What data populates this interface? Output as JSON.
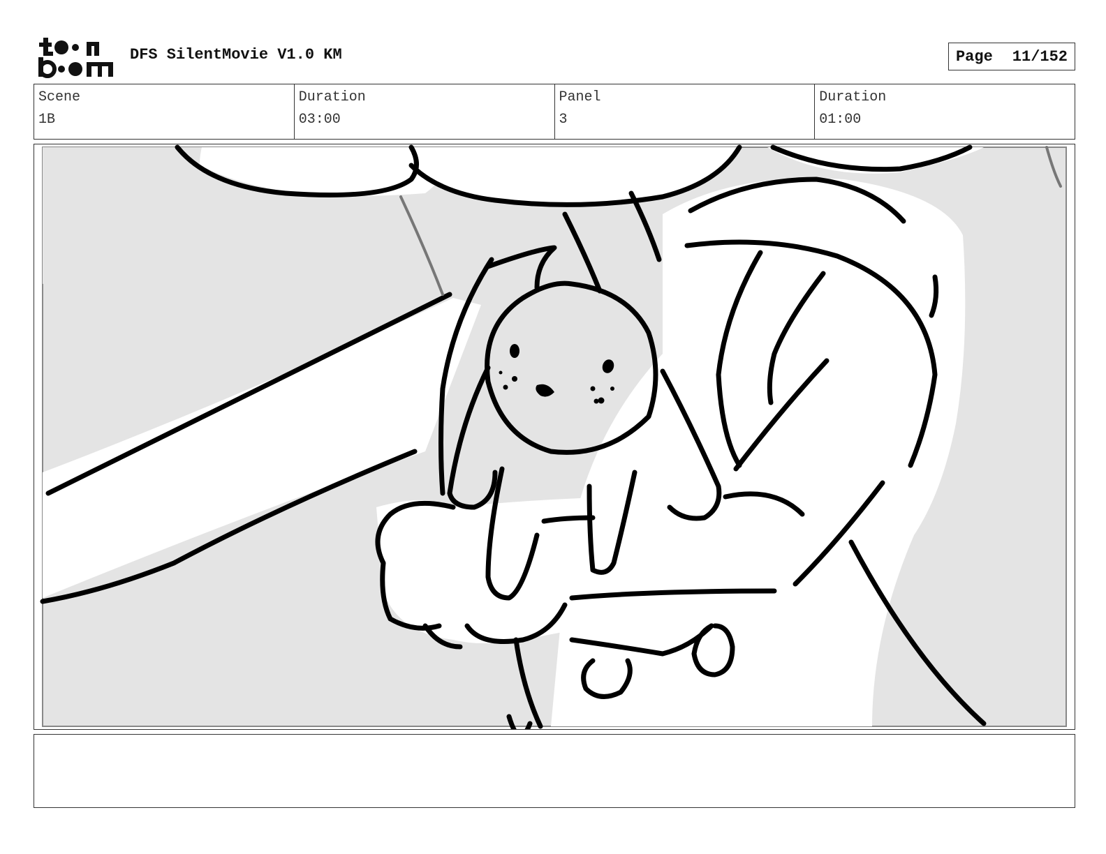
{
  "header": {
    "logo": {
      "line1": "toon",
      "line2": "boom"
    },
    "title": "DFS SilentMovie V1.0 KM",
    "page_label": "Page",
    "page_value": "11/152"
  },
  "info": {
    "scene_label": "Scene",
    "scene_value": "1B",
    "scene_duration_label": "Duration",
    "scene_duration_value": "03:00",
    "panel_label": "Panel",
    "panel_value": "3",
    "panel_duration_label": "Duration",
    "panel_duration_value": "01:00"
  },
  "notes": {
    "text": ""
  },
  "colors": {
    "background_gray": "#e4e4e4",
    "ink": "#000000",
    "frame": "#555555"
  }
}
